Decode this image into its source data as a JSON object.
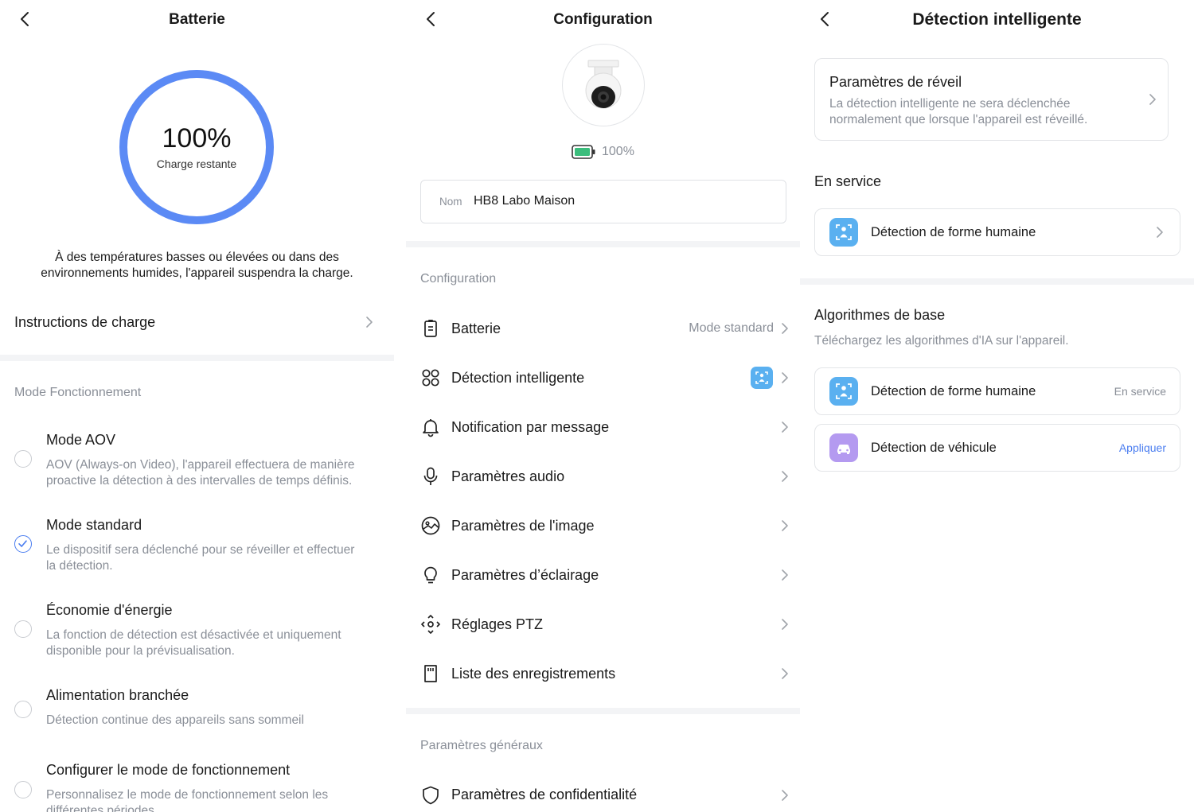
{
  "battery_panel": {
    "title": "Batterie",
    "percent": "100%",
    "percent_caption": "Charge restante",
    "charge_level": 1.0,
    "ring_color": "#5b8af5",
    "warning_line1": "À des températures basses ou élevées ou dans des",
    "warning_line2": "environnements humides, l'appareil suspendra la charge.",
    "instructions_label": "Instructions de charge",
    "mode_section_label": "Mode Fonctionnement",
    "modes": [
      {
        "title": "Mode AOV",
        "desc_line1": "AOV (Always-on Video), l'appareil effectuera de manière",
        "desc_line2": "proactive la détection à des intervalles de temps définis.",
        "selected": false
      },
      {
        "title": "Mode standard",
        "desc_line1": "Le dispositif sera déclenché pour se réveiller et effectuer",
        "desc_line2": "la détection.",
        "selected": true
      },
      {
        "title": "Économie d'énergie",
        "desc_line1": "La fonction de détection est désactivée et uniquement",
        "desc_line2": "disponible pour la prévisualisation.",
        "selected": false
      },
      {
        "title": "Alimentation branchée",
        "desc_line1": "Détection continue des appareils sans sommeil",
        "desc_line2": "",
        "selected": false
      },
      {
        "title": "Configurer le mode de fonctionnement",
        "desc_line1": "Personnalisez le mode de fonctionnement selon les",
        "desc_line2": "différentes périodes",
        "selected": false
      }
    ]
  },
  "config_panel": {
    "title": "Configuration",
    "battery_percent": "100%",
    "name_label": "Nom",
    "name_value": "HB8 Labo Maison",
    "section_config": "Configuration",
    "rows": [
      {
        "label": "Batterie",
        "value": "Mode standard",
        "icon": "battery-clipboard-icon"
      },
      {
        "label": "Détection intelligente",
        "value": "",
        "icon": "grid-circles-icon"
      },
      {
        "label": "Notification par message",
        "value": "",
        "icon": "bell-icon"
      },
      {
        "label": "Paramètres audio",
        "value": "",
        "icon": "microphone-icon"
      },
      {
        "label": "Paramètres de l'image",
        "value": "",
        "icon": "image-icon"
      },
      {
        "label": "Paramètres d’éclairage",
        "value": "",
        "icon": "lightbulb-icon"
      },
      {
        "label": "Réglages PTZ",
        "value": "",
        "icon": "ptz-icon"
      },
      {
        "label": "Liste des enregistrements",
        "value": "",
        "icon": "sd-card-icon"
      }
    ],
    "section_general": "Paramètres généraux",
    "privacy_label": "Paramètres de confidentialité"
  },
  "detection_panel": {
    "title": "Détection intelligente",
    "wake_title": "Paramètres de réveil",
    "wake_desc_line1": "La détection intelligente ne sera déclenchée",
    "wake_desc_line2": "normalement que lorsque l'appareil est réveillé.",
    "in_service_label": "En service",
    "in_service_item": "Détection de forme humaine",
    "algo_title": "Algorithmes de base",
    "algo_subtitle": "Téléchargez les algorithmes d'IA sur l'appareil.",
    "algo_items": [
      {
        "label": "Détection de forme humaine",
        "status": "En service",
        "status_color": "#8a8f98",
        "icon_color": "#5ab0f0",
        "icon": "human-shape-icon"
      },
      {
        "label": "Détection de véhicule",
        "status": "Appliquer",
        "status_color": "#4a7df0",
        "icon_color": "#b49af0",
        "icon": "car-icon"
      }
    ]
  }
}
